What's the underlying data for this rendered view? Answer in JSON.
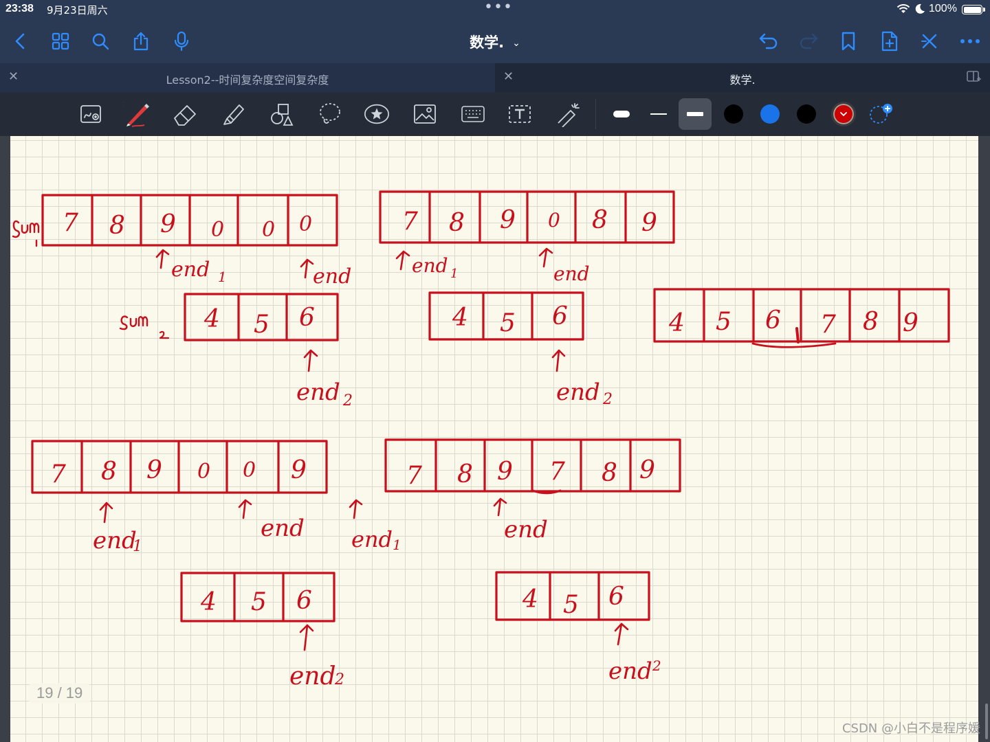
{
  "status_bar": {
    "time": "23:38",
    "date": "9月23日周六",
    "battery": "100%"
  },
  "nav": {
    "title": "数学.",
    "left_icons": [
      "chevron-left-icon",
      "grid-icon",
      "search-icon",
      "share-icon",
      "microphone-icon"
    ],
    "right_icons": [
      "undo-icon",
      "redo-icon",
      "bookmark-icon",
      "add-page-icon",
      "close-icon",
      "more-icon"
    ]
  },
  "tabs": [
    {
      "label": "Lesson2--时间复杂度空间复杂度",
      "active": false
    },
    {
      "label": "数学.",
      "active": true
    }
  ],
  "toolbar": {
    "tools": [
      "lasso-zoom-icon",
      "pen-icon",
      "eraser-icon",
      "highlighter-icon",
      "shapes-icon",
      "lasso-icon",
      "sticker-icon",
      "image-icon",
      "keyboard-icon",
      "text-box-icon",
      "laser-pointer-icon"
    ],
    "colors": [
      "#000000",
      "#1a73e8",
      "#000000",
      "#cc0000"
    ],
    "selected_color": "#cc0000"
  },
  "notes": {
    "diagrams": [
      {
        "cells": [
          "7",
          "8",
          "9",
          "0",
          "0",
          "0"
        ],
        "labels": [
          "sum1",
          "↑end1",
          "↑end"
        ]
      },
      {
        "cells": [
          "4",
          "5",
          "6"
        ],
        "labels": [
          "sum2",
          "↑",
          "end2"
        ]
      },
      {
        "cells": [
          "7",
          "8",
          "9",
          "0",
          "8",
          "9"
        ],
        "labels": [
          "↑end1",
          "↑end"
        ]
      },
      {
        "cells": [
          "4",
          "5",
          "6"
        ],
        "labels": [
          "↑",
          "end2"
        ]
      },
      {
        "cells": [
          "4",
          "5",
          "6",
          "7",
          "8",
          "9"
        ],
        "labels": []
      },
      {
        "cells": [
          "7",
          "8",
          "9",
          "0",
          "0",
          "9"
        ],
        "labels": [
          "↑",
          "end1",
          "↑end"
        ]
      },
      {
        "cells": [
          "4",
          "5",
          "6"
        ],
        "labels": [
          "↑",
          "end2"
        ]
      },
      {
        "cells": [
          "7",
          "8",
          "9",
          "7",
          "8",
          "9"
        ],
        "labels": [
          "↑",
          "end1",
          "↑",
          "end"
        ]
      },
      {
        "cells": [
          "4",
          "5",
          "6"
        ],
        "labels": [
          "↑",
          "end2"
        ]
      }
    ]
  },
  "page_counter": "19 / 19",
  "watermark": "CSDN @小白不是程序媛"
}
